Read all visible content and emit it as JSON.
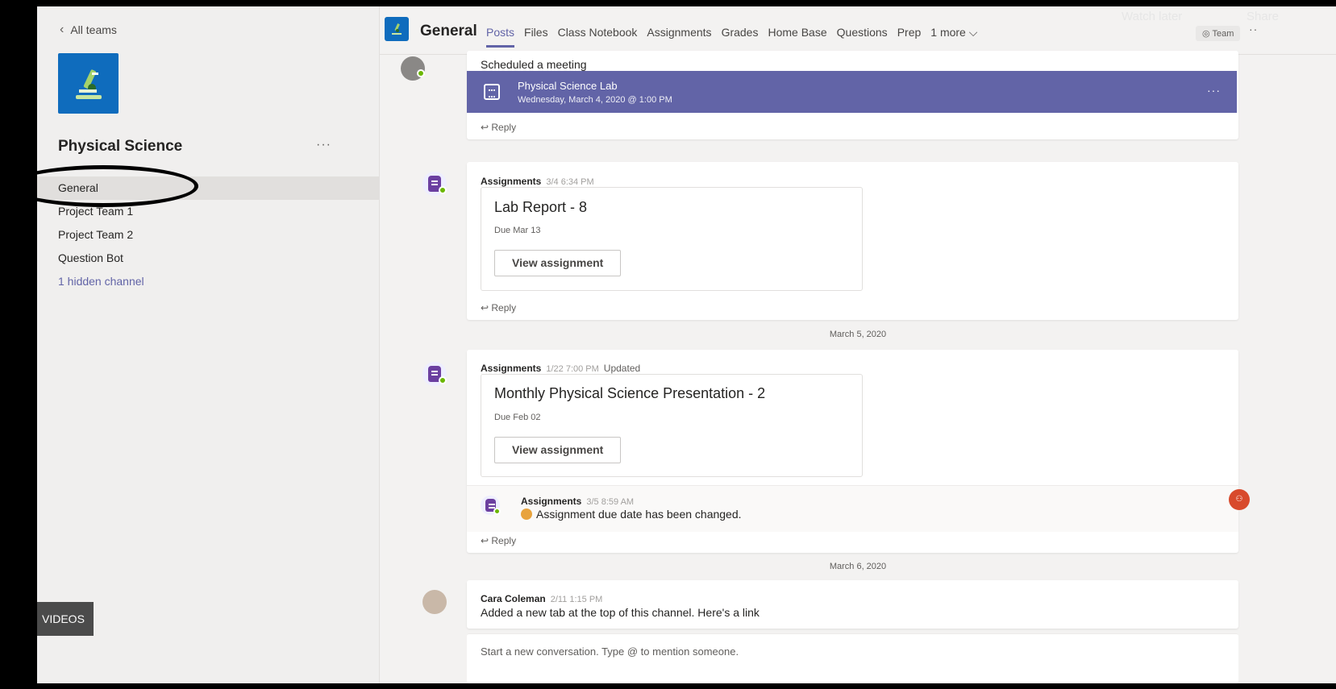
{
  "left": {
    "all_teams": "All teams",
    "team_name": "Physical Science",
    "team_more": "···",
    "channels": [
      "General",
      "Project Team 1",
      "Project Team 2",
      "Question Bot",
      "1 hidden channel"
    ],
    "videos": "VIDEOS"
  },
  "header": {
    "channel": "General",
    "tabs": [
      "Posts",
      "Files",
      "Class Notebook",
      "Assignments",
      "Grades",
      "Home Base",
      "Questions",
      "Prep",
      "1 more ⌵"
    ],
    "active_tab": "Posts",
    "watch_later": "Watch later",
    "share": "Share",
    "team_pill": "◎ Team",
    "more": "··"
  },
  "feed": {
    "meeting": {
      "label": "Scheduled a meeting",
      "title": "Physical Science Lab",
      "date": "Wednesday, March 4, 2020 @ 1:00 PM",
      "more": "···",
      "reply": "↩ Reply"
    },
    "post1": {
      "author": "Assignments",
      "time": "3/4 6:34 PM",
      "title": "Lab Report - 8",
      "due": "Due Mar 13",
      "button": "View assignment",
      "reply": "↩ Reply"
    },
    "divider1": "March 5, 2020",
    "post2": {
      "author": "Assignments",
      "time": "1/22 7:00 PM",
      "updated": "Updated",
      "title": "Monthly Physical Science Presentation - 2",
      "due": "Due Feb 02",
      "button": "View assignment",
      "sub_author": "Assignments",
      "sub_time": "3/5 8:59 AM",
      "sub_text": "Assignment due date has been changed.",
      "reply": "↩ Reply"
    },
    "divider2": "March 6, 2020",
    "post3": {
      "author": "Cara Coleman",
      "time": "2/11 1:15 PM",
      "text": "Added a new tab at the top of this channel. Here's a link"
    },
    "compose_placeholder": "Start a new conversation. Type @ to mention someone."
  },
  "colors": {
    "accent": "#6264a7",
    "team_blue": "#0f6cbd",
    "presence": "#6bb700"
  }
}
